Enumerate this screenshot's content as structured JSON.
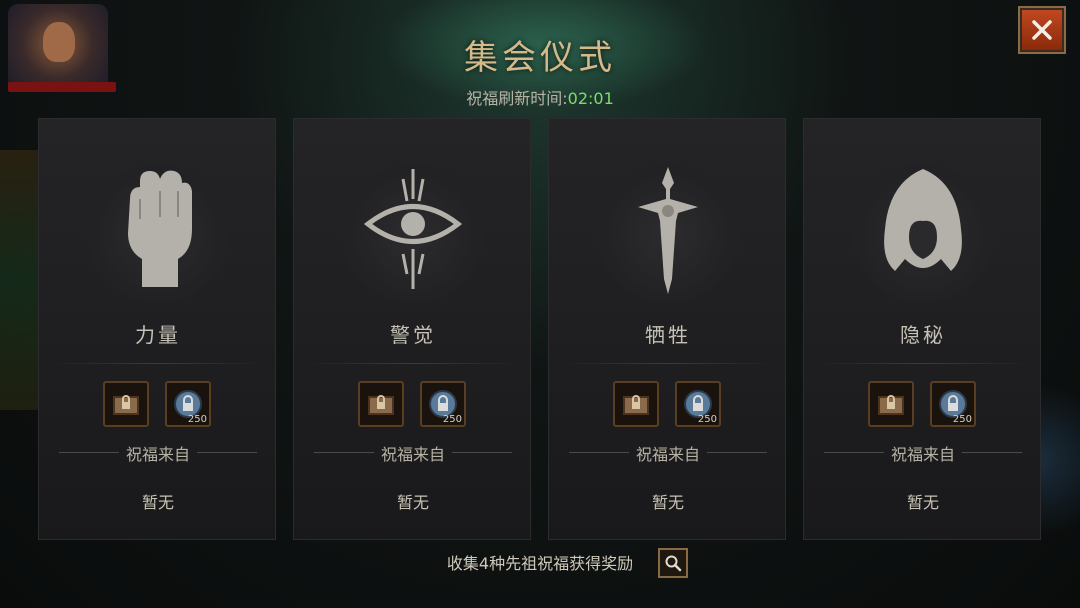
{
  "title": "集会仪式",
  "refresh": {
    "label": "祝福刷新时间:",
    "time": "02:01"
  },
  "close_icon": "close-icon",
  "cards": [
    {
      "name": "力量",
      "emblem": "fist-icon",
      "items": [
        {
          "icon": "lock-chest-icon"
        },
        {
          "icon": "lock-orb-icon",
          "count": "250"
        }
      ],
      "from_label": "祝福来自",
      "from_value": "暂无"
    },
    {
      "name": "警觉",
      "emblem": "eye-icon",
      "items": [
        {
          "icon": "lock-chest-icon"
        },
        {
          "icon": "lock-orb-icon",
          "count": "250"
        }
      ],
      "from_label": "祝福来自",
      "from_value": "暂无"
    },
    {
      "name": "牺牲",
      "emblem": "dagger-icon",
      "items": [
        {
          "icon": "lock-chest-icon"
        },
        {
          "icon": "lock-orb-icon",
          "count": "250"
        }
      ],
      "from_label": "祝福来自",
      "from_value": "暂无"
    },
    {
      "name": "隐秘",
      "emblem": "hood-icon",
      "items": [
        {
          "icon": "lock-chest-icon"
        },
        {
          "icon": "lock-orb-icon",
          "count": "250"
        }
      ],
      "from_label": "祝福来自",
      "from_value": "暂无"
    }
  ],
  "footer": {
    "text": "收集4种先祖祝福获得奖励",
    "button_icon": "magnifier-icon"
  },
  "colors": {
    "title": "#d4b98a",
    "timer": "#7fdc6b",
    "close_bg": "#c04820"
  }
}
